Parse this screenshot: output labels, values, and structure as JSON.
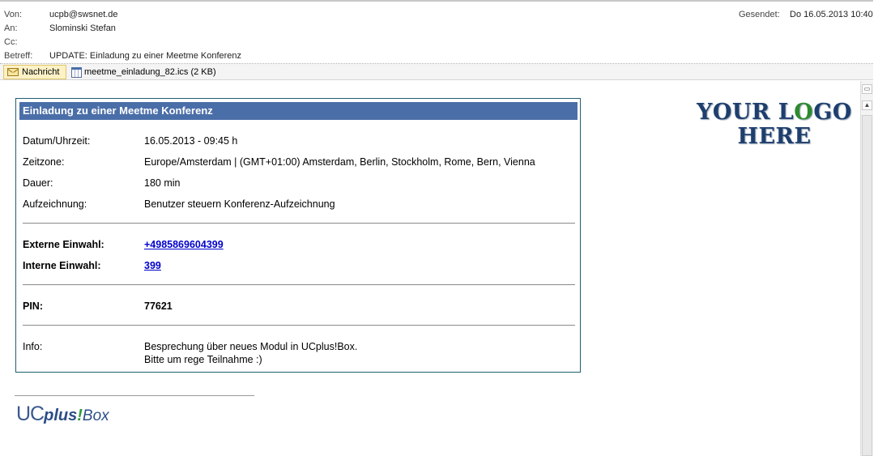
{
  "header": {
    "from_label": "Von:",
    "from_value": "ucpb@swsnet.de",
    "to_label": "An:",
    "to_value": "Slominski Stefan",
    "cc_label": "Cc:",
    "cc_value": "",
    "subject_label": "Betreff:",
    "subject_value": "UPDATE: Einladung zu einer Meetme Konferenz",
    "sent_label": "Gesendet:",
    "sent_value": "Do 16.05.2013 10:40"
  },
  "attachments": {
    "message_tab": "Nachricht",
    "file_tab": "meetme_einladung_82.ics (2 KB)"
  },
  "invite": {
    "title": "Einladung zu einer Meetme Konferenz",
    "datetime_label": "Datum/Uhrzeit:",
    "datetime_value": "16.05.2013 - 09:45 h",
    "timezone_label": "Zeitzone:",
    "timezone_value": "Europe/Amsterdam | (GMT+01:00) Amsterdam, Berlin, Stockholm, Rome, Bern, Vienna",
    "duration_label": "Dauer:",
    "duration_value": "180 min",
    "recording_label": "Aufzeichnung:",
    "recording_value": "Benutzer steuern Konferenz-Aufzeichnung",
    "external_label": "Externe Einwahl:",
    "external_value": "+4985869604399",
    "internal_label": "Interne Einwahl:",
    "internal_value": "399",
    "pin_label": "PIN:",
    "pin_value": "77621",
    "info_label": "Info:",
    "info_line1": "Besprechung über neues Modul in UCplus!Box.",
    "info_line2": "Bitte um rege Teilnahme :)"
  },
  "logo": {
    "line1_a": "YOUR L",
    "line1_o": "O",
    "line1_b": "GO",
    "line2": "HERE"
  },
  "signature": {
    "uc": "UC",
    "plus": "plus",
    "bang": "!",
    "box": "Box"
  },
  "colors": {
    "header_bar": "#4a6ea8",
    "card_border": "#1f5f6e",
    "link": "#0000cc"
  }
}
